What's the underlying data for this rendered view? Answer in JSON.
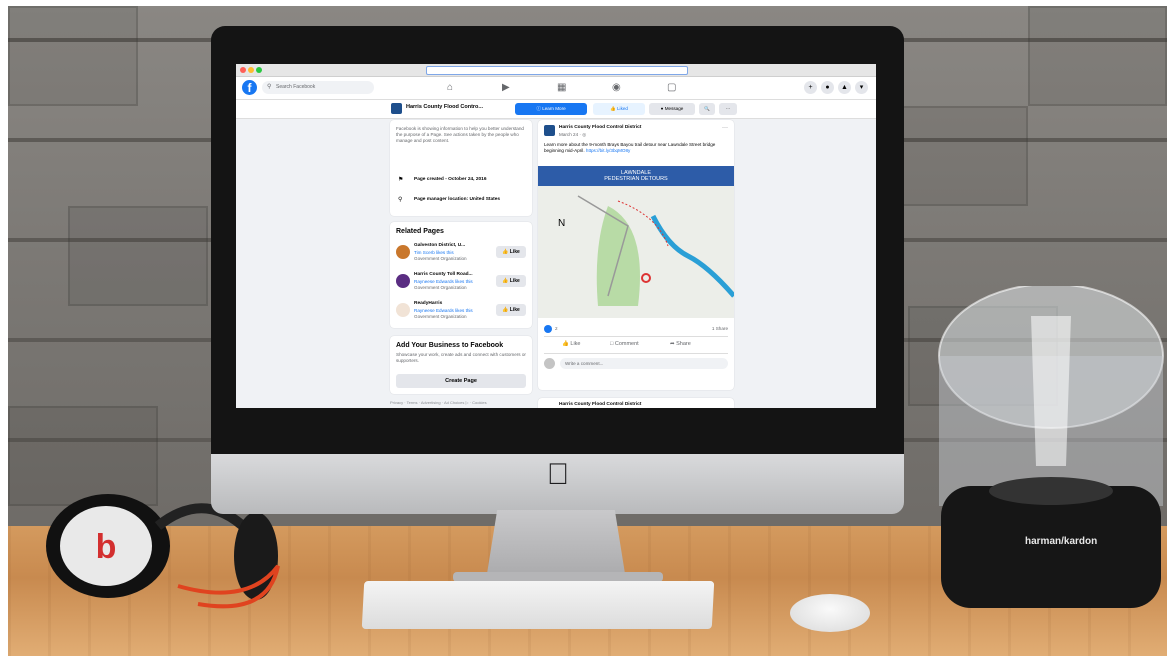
{
  "browser": {
    "search_placeholder": "Search Facebook"
  },
  "page": {
    "name": "Harris County Flood Contro...",
    "buttons": {
      "learn_more": "Learn More",
      "liked": "Liked",
      "message": "Message",
      "search_icon": "🔍",
      "more": "···"
    }
  },
  "about": {
    "description": "Facebook is showing information to help you better understand the purpose of a Page. See actions taken by the people who manage and post content.",
    "created": "Page created - October 24, 2016",
    "location": "Page manager location: United States"
  },
  "related": {
    "title": "Related Pages",
    "items": [
      {
        "name": "Galveston District, U...",
        "sub1": "Tim Scerb likes this",
        "sub2": "Government Organization",
        "like": "Like"
      },
      {
        "name": "Harris County Toll Road...",
        "sub1": "Rayneese Edwards likes this",
        "sub2": "Government Organization",
        "like": "Like"
      },
      {
        "name": "ReadyHarris",
        "sub1": "Rayneese Edwards likes this",
        "sub2": "Government Organization",
        "like": "Like"
      }
    ]
  },
  "business": {
    "title": "Add Your Business to Facebook",
    "text": "Showcase your work, create ads and connect with customers or supporters.",
    "button": "Create Page"
  },
  "footer": "Privacy · Terms · Advertising · Ad Choices ▷ · Cookies",
  "post": {
    "author": "Harris County Flood Control District",
    "date": "March 24 · ",
    "text": "Learn more about the 9-month Brays Bayou trail detour near Lawndale Street bridge beginning mid-April.",
    "link": "https://bit.ly/3bqMO8y",
    "map_title_1": "LAWNDALE",
    "map_title_2": "PEDESTRIAN DETOURS",
    "reactions": "2",
    "shares": "1 Share",
    "actions": {
      "like": "Like",
      "comment": "Comment",
      "share": "Share"
    },
    "comment_placeholder": "Write a comment...",
    "next_author": "Harris County Flood Control District"
  },
  "brand": "harman/kardon",
  "colors": {
    "facebook_blue": "#1877f2",
    "map_banner": "#2d5ca8"
  }
}
